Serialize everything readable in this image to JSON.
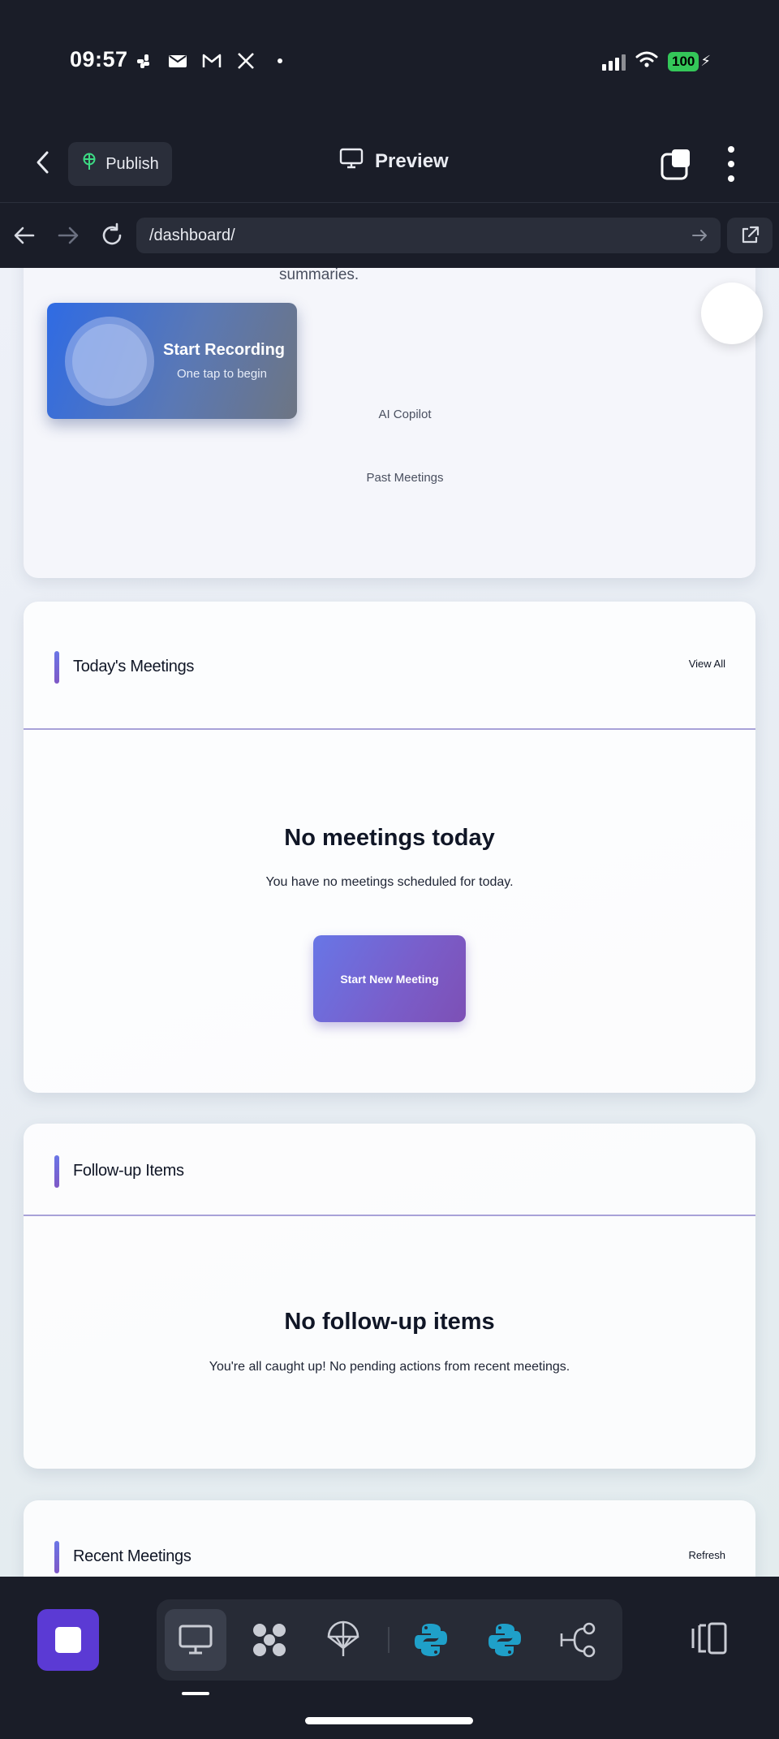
{
  "status_bar": {
    "time": "09:57",
    "battery": "100",
    "icons": [
      "slack-icon",
      "mail-icon",
      "gmail-icon",
      "x-icon",
      "dot-icon"
    ]
  },
  "header": {
    "publish_label": "Publish",
    "preview_label": "Preview"
  },
  "url_bar": {
    "url": "/dashboard/"
  },
  "hero": {
    "summary_fragment": "summaries.",
    "record_title": "Start Recording",
    "record_subtitle": "One tap to begin",
    "links": [
      "AI Copilot",
      "Past Meetings"
    ]
  },
  "todays_meetings": {
    "title": "Today's Meetings",
    "action": "View All",
    "empty_title": "No meetings today",
    "empty_text": "You have no meetings scheduled for today.",
    "button_label": "Start New Meeting"
  },
  "follow_up": {
    "title": "Follow-up Items",
    "empty_title": "No follow-up items",
    "empty_text": "You're all caught up! No pending actions from recent meetings."
  },
  "recent_meetings": {
    "title": "Recent Meetings",
    "action": "Refresh"
  },
  "dock": {
    "tools": [
      "monitor-icon",
      "grid-flower-icon",
      "parachute-icon",
      "python-icon",
      "python-icon",
      "workflow-icon"
    ],
    "accent": "#5b3ad4"
  }
}
